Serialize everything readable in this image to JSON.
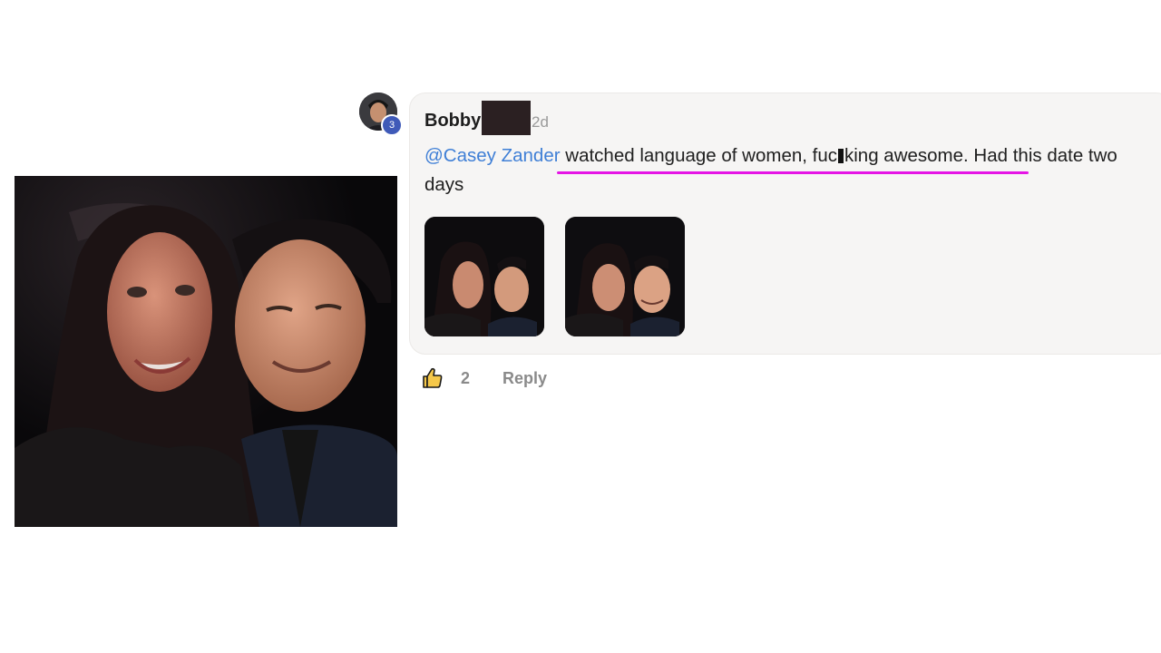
{
  "comment": {
    "author": "Bobby",
    "level_badge": "3",
    "timestamp": "2d",
    "mention": "@Casey Zander",
    "text_before_cursor": " watched language of women, fuc",
    "text_after_cursor": "king awesome. Had this date two days",
    "likes_count": "2",
    "reply_label": "Reply"
  },
  "icons": {
    "like": "thumbs-up-icon"
  },
  "colors": {
    "mention": "#3f7fd6",
    "highlight_underline": "#e515e5",
    "bubble_background": "#f6f5f4",
    "level_badge": "#3f5ab8",
    "action_text": "#8a8a8a"
  }
}
